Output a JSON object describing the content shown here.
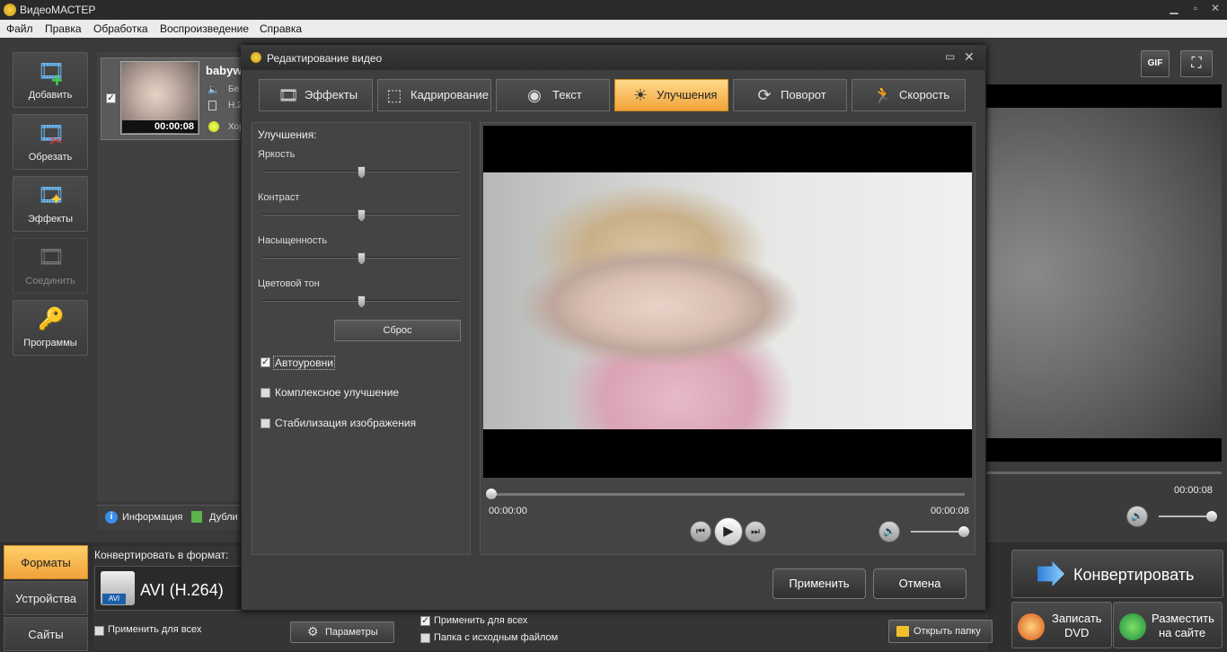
{
  "window": {
    "title": "ВидеоМАСТЕР"
  },
  "menu": [
    "Файл",
    "Правка",
    "Обработка",
    "Воспроизведение",
    "Справка"
  ],
  "sidebar": {
    "items": [
      {
        "label": "Добавить",
        "icon": "film-plus-icon"
      },
      {
        "label": "Обрезать",
        "icon": "film-scissors-icon"
      },
      {
        "label": "Эффекты",
        "icon": "film-magic-icon"
      },
      {
        "label": "Соединить",
        "icon": "film-join-icon",
        "disabled": true
      },
      {
        "label": "Программы",
        "icon": "key-icon"
      }
    ]
  },
  "file": {
    "name": "babyw",
    "duration": "00:00:08",
    "audio": "Бе",
    "codec": "H.2",
    "quality": "Хор"
  },
  "file_panel": {
    "info_label": "Информация",
    "duplicate_label": "Дубли"
  },
  "preview": {
    "time": "00:00:08",
    "gif_label": "GIF"
  },
  "bottom": {
    "tabs": [
      "Форматы",
      "Устройства",
      "Сайты"
    ],
    "convert_to_label": "Конвертировать в формат:",
    "format": "AVI (H.264)",
    "format_badge": "AVI",
    "apply_all_left": "Применить для всех",
    "params_label": "Параметры",
    "apply_all_right": "Применить для всех",
    "source_folder": "Папка с исходным файлом",
    "open_folder": "Открыть папку",
    "convert_label": "Конвертировать",
    "burn_dvd": [
      "Записать",
      "DVD"
    ],
    "publish": [
      "Разместить",
      "на сайте"
    ]
  },
  "dialog": {
    "title": "Редактирование видео",
    "tabs": [
      {
        "label": "Эффекты",
        "icon": "film-effects-icon"
      },
      {
        "label": "Кадрирование",
        "icon": "crop-icon"
      },
      {
        "label": "Текст",
        "icon": "text-icon"
      },
      {
        "label": "Улучшения",
        "icon": "sun-icon",
        "active": true
      },
      {
        "label": "Поворот",
        "icon": "rotate-icon"
      },
      {
        "label": "Скорость",
        "icon": "running-icon"
      }
    ],
    "section_title": "Улучшения:",
    "sliders": [
      {
        "label": "Яркость",
        "value": 0.5
      },
      {
        "label": "Контраст",
        "value": 0.5
      },
      {
        "label": "Насыщенность",
        "value": 0.5
      },
      {
        "label": "Цветовой тон",
        "value": 0.5
      }
    ],
    "reset_label": "Сброс",
    "options": [
      {
        "label": "Автоуровни",
        "checked": true
      },
      {
        "label": "Комплексное улучшение",
        "checked": false
      },
      {
        "label": "Стабилизация изображения",
        "checked": false
      }
    ],
    "time_start": "00:00:00",
    "time_end": "00:00:08",
    "apply_label": "Применить",
    "cancel_label": "Отмена"
  },
  "colors": {
    "accent": "#f2a33a",
    "accent_light": "#ffd98a",
    "bg": "#3a3a3a"
  }
}
